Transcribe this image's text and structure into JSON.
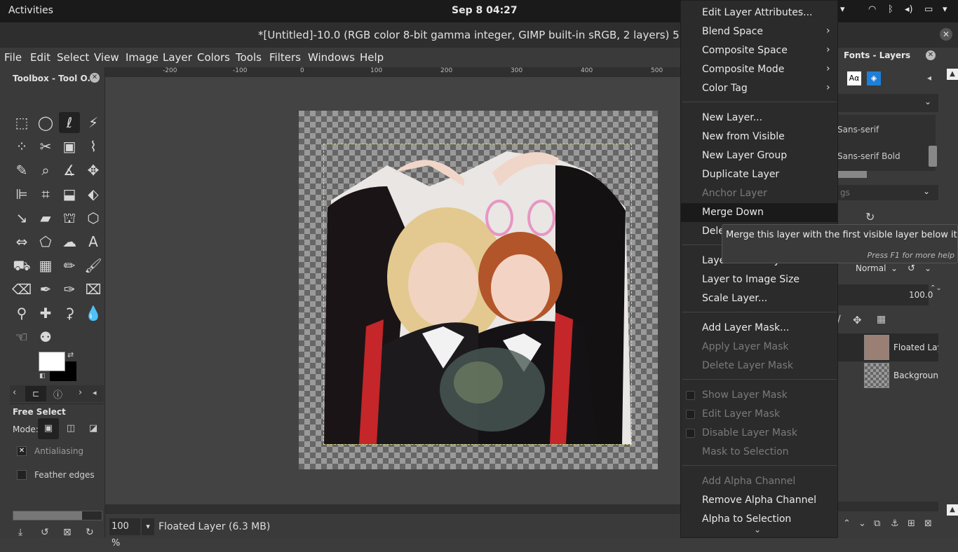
{
  "system": {
    "activities": "Activities",
    "clock": "Sep 8  04:27"
  },
  "window": {
    "title": "*[Untitled]-10.0 (RGB color 8-bit gamma integer, GIMP built-in sRGB, 2 layers) 512x512 – G"
  },
  "menubar": [
    "File",
    "Edit",
    "Select",
    "View",
    "Image",
    "Layer",
    "Colors",
    "Tools",
    "Filters",
    "Windows",
    "Help"
  ],
  "toolbox": {
    "title": "Toolbox - Tool O...",
    "tool_options": {
      "title": "Free Select",
      "mode_label": "Mode:",
      "antialiasing": "Antialiasing",
      "feather_edges": "Feather edges"
    },
    "colors": {
      "foreground": "#ffffff",
      "background": "#000000"
    }
  },
  "rulers": {
    "h_ticks": [
      "-200",
      "-100",
      "0",
      "100",
      "200",
      "300",
      "400",
      "500"
    ]
  },
  "statusbar": {
    "zoom": "100 %",
    "layer_info": "Floated Layer (6.3 MB)"
  },
  "right_dock": {
    "tab_title": "Fonts - Layers",
    "fonts": [
      "Sans-serif",
      "Sans-serif Bold"
    ],
    "tags_placeholder": "gs",
    "layer_mode": "Normal",
    "opacity": "100.0",
    "layers": [
      "Floated Lay",
      "Backgroun"
    ]
  },
  "context_menu": {
    "items": [
      {
        "label": "Edit Layer Attributes...",
        "disabled": false
      },
      {
        "label": "Blend Space",
        "submenu": true
      },
      {
        "label": "Composite Space",
        "submenu": true
      },
      {
        "label": "Composite Mode",
        "submenu": true
      },
      {
        "label": "Color Tag",
        "submenu": true
      },
      {
        "label": "New Layer..."
      },
      {
        "label": "New from Visible"
      },
      {
        "label": "New Layer Group"
      },
      {
        "label": "Duplicate Layer"
      },
      {
        "label": "Anchor Layer",
        "disabled": true
      },
      {
        "label": "Merge Down",
        "highlighted": true
      },
      {
        "label": "Dele"
      },
      {
        "label": "Layer Boundary Size..."
      },
      {
        "label": "Layer to Image Size"
      },
      {
        "label": "Scale Layer..."
      },
      {
        "label": "Add Layer Mask..."
      },
      {
        "label": "Apply Layer Mask",
        "disabled": true
      },
      {
        "label": "Delete Layer Mask",
        "disabled": true
      },
      {
        "label": "Show Layer Mask",
        "disabled": true
      },
      {
        "label": "Edit Layer Mask",
        "disabled": true
      },
      {
        "label": "Disable Layer Mask",
        "disabled": true
      },
      {
        "label": "Mask to Selection",
        "disabled": true
      },
      {
        "label": "Add Alpha Channel",
        "disabled": true
      },
      {
        "label": "Remove Alpha Channel"
      },
      {
        "label": "Alpha to Selection"
      }
    ]
  },
  "tooltip": {
    "text": "Merge this layer with the first visible layer below it",
    "help": "Press F1 for more help"
  },
  "icons": {
    "toolbox_tools": [
      "rect-select-icon",
      "ellipse-select-icon",
      "free-select-icon",
      "fuzzy-select-icon",
      "select-by-color-icon",
      "scissors-icon",
      "foreground-select-icon",
      "paths-icon",
      "color-picker-icon",
      "zoom-icon",
      "measure-icon",
      "move-icon",
      "align-icon",
      "crop-icon",
      "unified-transform-icon",
      "warp-transform-icon",
      "perspective-clone-icon",
      "shear-icon",
      "handle-transform-icon",
      "3d-transform-icon",
      "flip-icon",
      "cage-transform-icon",
      "blend-icon",
      "text-icon",
      "bucket-fill-icon",
      "gradient-icon",
      "pencil-icon",
      "paintbrush-icon",
      "eraser-icon",
      "airbrush-icon",
      "ink-icon",
      "mypaint-brush-icon",
      "clone-icon",
      "heal-icon",
      "perspective-clone-icon-2",
      "blur-icon",
      "smudge-icon",
      "dodge-burn-icon"
    ]
  }
}
